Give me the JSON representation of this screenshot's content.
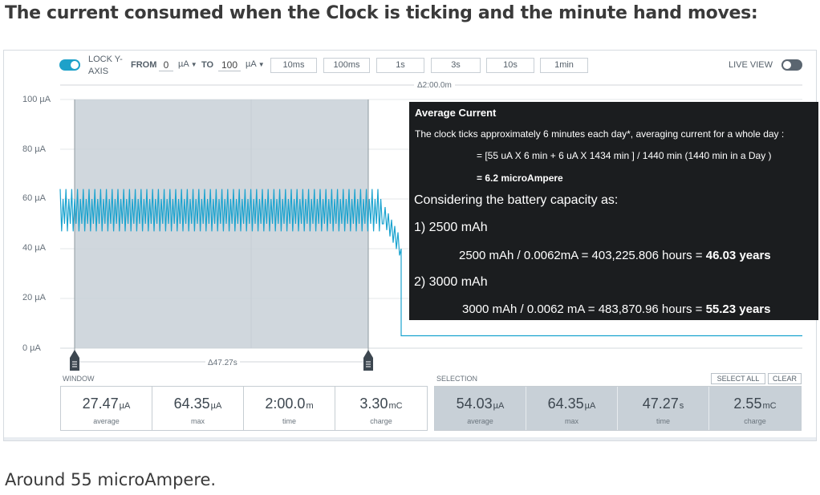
{
  "heading": "The current consumed when the Clock is ticking and the minute hand moves:",
  "footer": "Around 55 microAmpere.",
  "toolbar": {
    "lock_label": "LOCK Y-AXIS",
    "from_label": "FROM",
    "from_value": "0",
    "from_unit": "µA",
    "to_label": "TO",
    "to_value": "100",
    "to_unit": "µA",
    "ranges": [
      "10ms",
      "100ms",
      "1s",
      "3s",
      "10s",
      "1min"
    ],
    "live_label": "LIVE VIEW",
    "lock_on": true,
    "live_on": false
  },
  "chart": {
    "y_ticks": [
      "100 µA",
      "80 µA",
      "60 µA",
      "40 µA",
      "20 µA",
      "0 µA"
    ],
    "window_delta": "Δ2:00.0m",
    "selection_delta": "Δ47.27s"
  },
  "chart_data": {
    "type": "line",
    "ylim": [
      0,
      100
    ],
    "y_unit": "µA",
    "x_range_minutes": 2.0,
    "selection_seconds": 47.27,
    "ticking": {
      "min": 47,
      "max": 64,
      "mean": 54.03
    },
    "idle": {
      "value": 5
    }
  },
  "info": {
    "title": "Average Current",
    "line1": "The clock ticks approximately 6 minutes each day*, averaging current for a whole day :",
    "line2": "= [55 uA X 6 min   +   6 uA X 1434 min ] / 1440 min   (1440 min in a Day )",
    "line3": "= 6.2 microAmpere",
    "consider": "Considering the battery capacity as:",
    "cap1_label": "1) 2500 mAh",
    "cap1_calc": "2500 mAh /  0.0062mA = 403,225.806 hours =",
    "cap1_result": "46.03 years",
    "cap2_label": "2) 3000 mAh",
    "cap2_calc": "3000 mAh / 0.0062 mA = 483,870.96 hours =",
    "cap2_result": "55.23 years"
  },
  "window": {
    "label": "WINDOW",
    "stats": [
      {
        "value": "27.47",
        "unit": "µA",
        "caption": "average"
      },
      {
        "value": "64.35",
        "unit": "µA",
        "caption": "max"
      },
      {
        "value": "2:00.0",
        "unit": "m",
        "caption": "time"
      },
      {
        "value": "3.30",
        "unit": "mC",
        "caption": "charge"
      }
    ]
  },
  "selection": {
    "label": "SELECTION",
    "select_all": "SELECT ALL",
    "clear": "CLEAR",
    "stats": [
      {
        "value": "54.03",
        "unit": "µA",
        "caption": "average"
      },
      {
        "value": "64.35",
        "unit": "µA",
        "caption": "max"
      },
      {
        "value": "47.27",
        "unit": "s",
        "caption": "time"
      },
      {
        "value": "2.55",
        "unit": "mC",
        "caption": "charge"
      }
    ]
  },
  "colors": {
    "accent": "#1ea1c9",
    "signal": "#1aa3cf",
    "selection_fill": "#c8d0d7",
    "overlay": "#1b1d1f"
  }
}
